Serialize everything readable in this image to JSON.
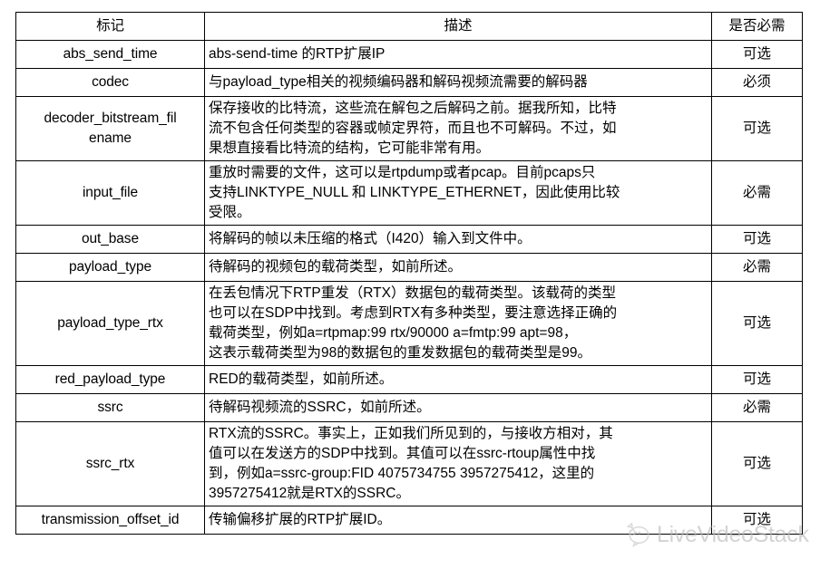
{
  "table": {
    "headers": {
      "name": "标记",
      "description": "描述",
      "required": "是否必需"
    },
    "rows": [
      {
        "name": "abs_send_time",
        "description_lines": [
          "abs-send-time 的RTP扩展IP"
        ],
        "required": "可选"
      },
      {
        "name": "codec",
        "description_lines": [
          "与payload_type相关的视频编码器和解码视频流需要的解码器"
        ],
        "required": "必须"
      },
      {
        "name": "decoder_bitstream_fil ename",
        "name_lines": [
          "decoder_bitstream_fil",
          "ename"
        ],
        "description_lines": [
          "保存接收的比特流，这些流在解包之后解码之前。据我所知，比特",
          "流不包含任何类型的容器或帧定界符，而且也不可解码。不过，如",
          "果想直接看比特流的结构，它可能非常有用。"
        ],
        "required": "可选"
      },
      {
        "name": "input_file",
        "description_lines": [
          "重放时需要的文件，这可以是rtpdump或者pcap。目前pcaps只",
          "支持LINKTYPE_NULL 和 LINKTYPE_ETHERNET，因此使用比较",
          "受限。"
        ],
        "required": "必需"
      },
      {
        "name": "out_base",
        "description_lines": [
          "将解码的帧以未压缩的格式（I420）输入到文件中。"
        ],
        "required": "可选"
      },
      {
        "name": "payload_type",
        "description_lines": [
          "待解码的视频包的载荷类型，如前所述。"
        ],
        "required": "必需"
      },
      {
        "name": "payload_type_rtx",
        "description_lines": [
          "在丢包情况下RTP重发（RTX）数据包的载荷类型。该载荷的类型",
          "也可以在SDP中找到。考虑到RTX有多种类型，要注意选择正确的",
          "载荷类型，例如a=rtpmap:99 rtx/90000 a=fmtp:99 apt=98，",
          "这表示载荷类型为98的数据包的重发数据包的载荷类型是99。"
        ],
        "required": "可选"
      },
      {
        "name": "red_payload_type",
        "description_lines": [
          "RED的载荷类型，如前所述。"
        ],
        "required": "可选"
      },
      {
        "name": "ssrc",
        "description_lines": [
          "待解码视频流的SSRC，如前所述。"
        ],
        "required": "必需"
      },
      {
        "name": "ssrc_rtx",
        "description_lines": [
          "RTX流的SSRC。事实上，正如我们所见到的，与接收方相对，其",
          "值可以在发送方的SDP中找到。其值可以在ssrc-rtoup属性中找",
          "到，例如a=ssrc-group:FID 4075734755 3957275412，这里的",
          "3957275412就是RTX的SSRC。"
        ],
        "required": "可选"
      },
      {
        "name": "transmission_offset_id",
        "description_lines": [
          "传输偏移扩展的RTP扩展ID。"
        ],
        "required": "可选"
      }
    ]
  },
  "watermark": {
    "text": "LiveVideoStack",
    "logo_icon": "speech-bubble-icon",
    "color": "#b9b9b9"
  }
}
